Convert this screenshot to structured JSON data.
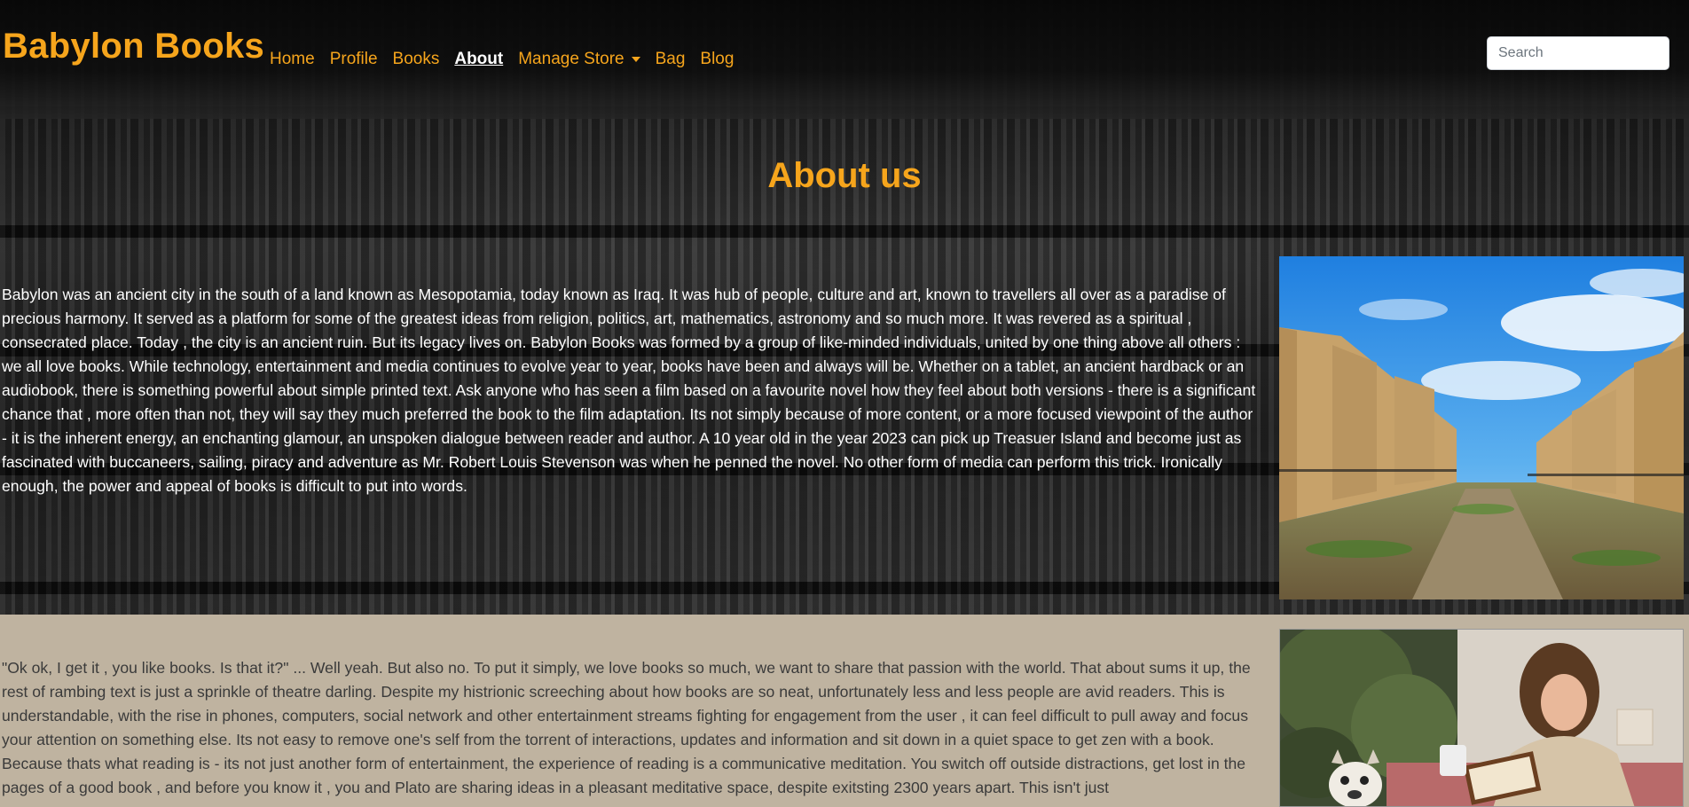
{
  "brand": "Babylon Books",
  "nav": {
    "home": "Home",
    "profile": "Profile",
    "books": "Books",
    "about": "About",
    "manage_store": "Manage Store",
    "bag": "Bag",
    "blog": "Blog"
  },
  "search": {
    "placeholder": "Search",
    "value": ""
  },
  "about": {
    "title": "About us",
    "paragraph1": "Babylon was an ancient city in the south of a land known as Mesopotamia, today known as Iraq. It was hub of people, culture and art, known to travellers all over as a paradise of precious harmony. It served as a platform for some of the greatest ideas from religion, politics, art, mathematics, astronomy and so much more. It was revered as a spiritual , consecrated place. Today , the city is an ancient ruin. But its legacy lives on. Babylon Books was formed by a group of like-minded individuals, united by one thing above all others : we all love books. While technology, entertainment and media continues to evolve year to year, books have been and always will be. Whether on a tablet, an ancient hardback or an audiobook, there is something powerful about simple printed text. Ask anyone who has seen a film based on a favourite novel how they feel about both versions - there is a significant chance that , more often than not, they will say they much preferred the book to the film adaptation. Its not simply because of more content, or a more focused viewpoint of the author - it is the inherent energy, an enchanting glamour, an unspoken dialogue between reader and author. A 10 year old in the year 2023 can pick up Treasuer Island and become just as fascinated with buccaneers, sailing, piracy and adventure as Mr. Robert Louis Stevenson was when he penned the novel. No other form of media can perform this trick. Ironically enough, the power and appeal of books is difficult to put into words.",
    "paragraph2": "\"Ok ok, I get it , you like books. Is that it?\" ... Well yeah. But also no. To put it simply, we love books so much, we want to share that passion with the world. That about sums it up, the rest of rambing text is just a sprinkle of theatre darling. Despite my histrionic screeching about how books are so neat, unfortunately less and less people are avid readers. This is understandable, with the rise in phones, computers, social network and other entertainment streams fighting for engagement from the user , it can feel difficult to pull away and focus your attention on something else. Its not easy to remove one's self from the torrent of interactions, updates and information and sit down in a quiet space to get zen with a book. Because thats what reading is - its not just another form of entertainment, the experience of reading is a communicative meditation. You switch off outside distractions, get lost in the pages of a good book , and before you know it , you and Plato are sharing ideas in a pleasant meditative space, despite exitsting 2300 years apart. This isn't just"
  },
  "colors": {
    "accent": "#f6a51c",
    "lower_bg": "#bfb3a0"
  }
}
